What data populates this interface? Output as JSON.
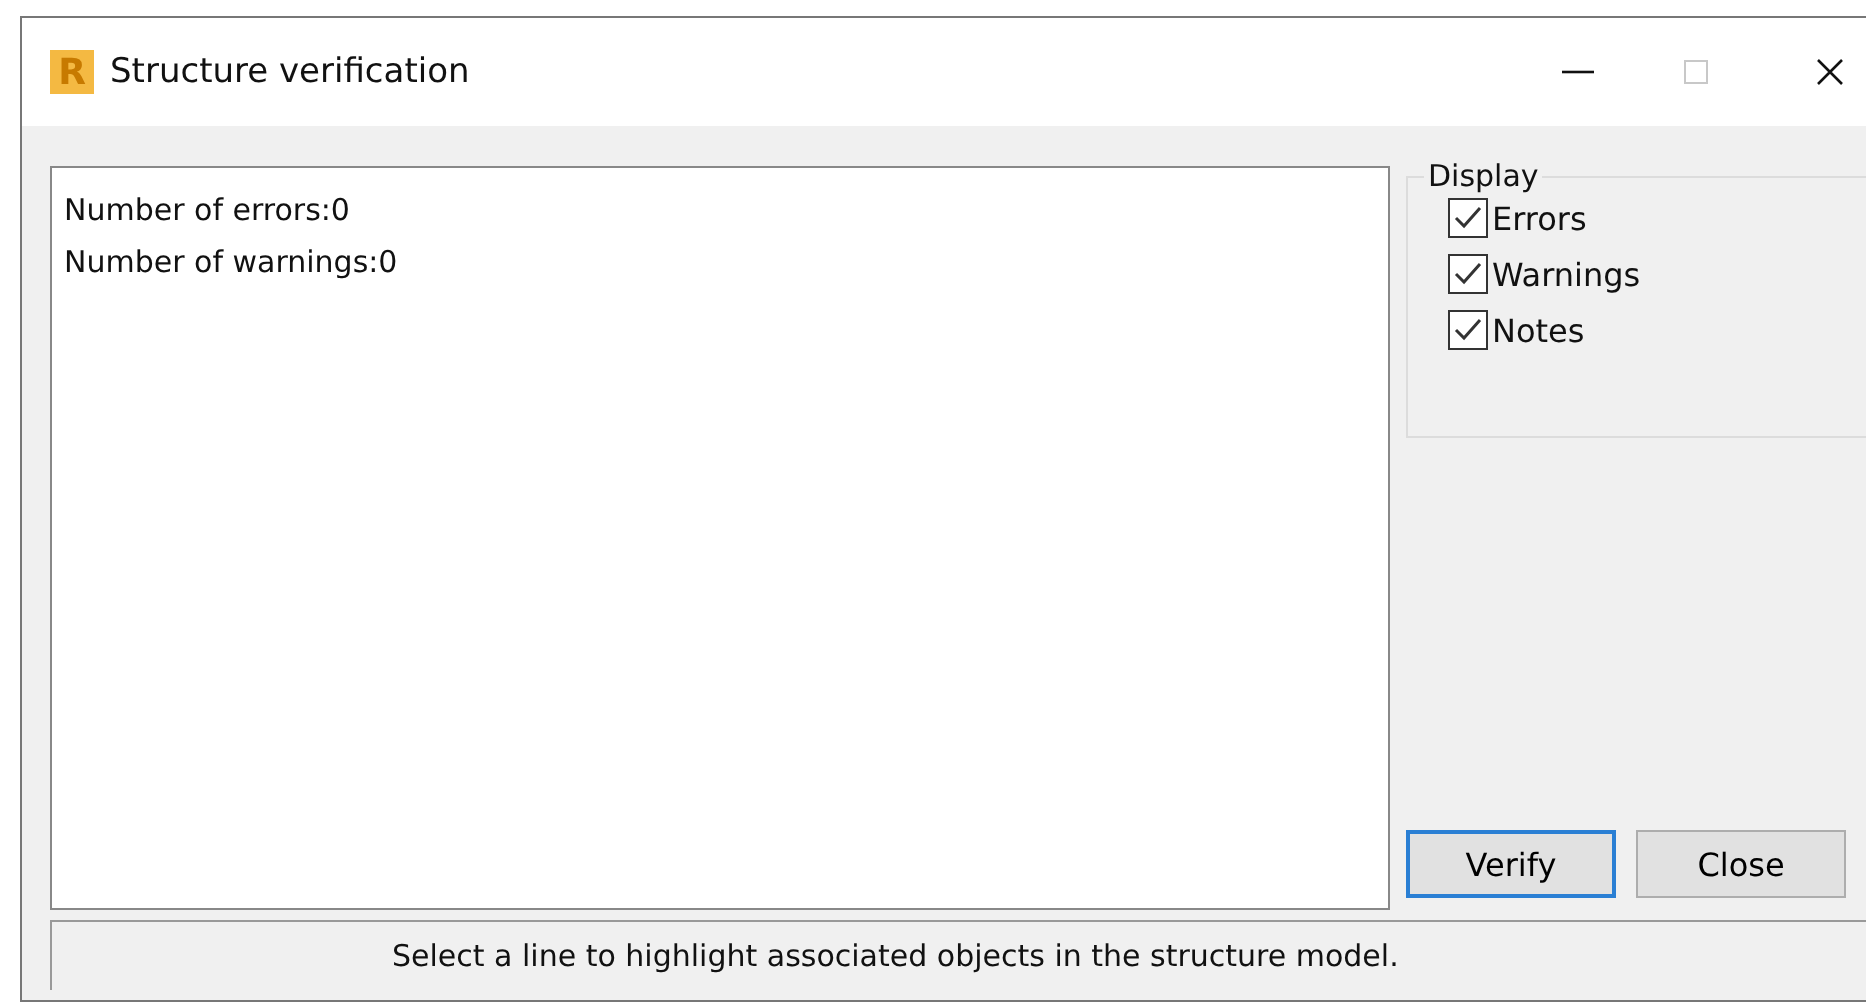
{
  "window": {
    "title": "Structure verification",
    "app_icon": "R"
  },
  "results": [
    "Number of errors:0",
    "Number of warnings:0"
  ],
  "display": {
    "title": "Display",
    "options": [
      {
        "label": "Errors",
        "checked": true
      },
      {
        "label": "Warnings",
        "checked": true
      },
      {
        "label": "Notes",
        "checked": true
      }
    ]
  },
  "buttons": [
    {
      "label": "Verify",
      "default": true
    },
    {
      "label": "Close",
      "default": false
    }
  ],
  "status_bar": "Select a line to highlight associated objects in the structure model."
}
